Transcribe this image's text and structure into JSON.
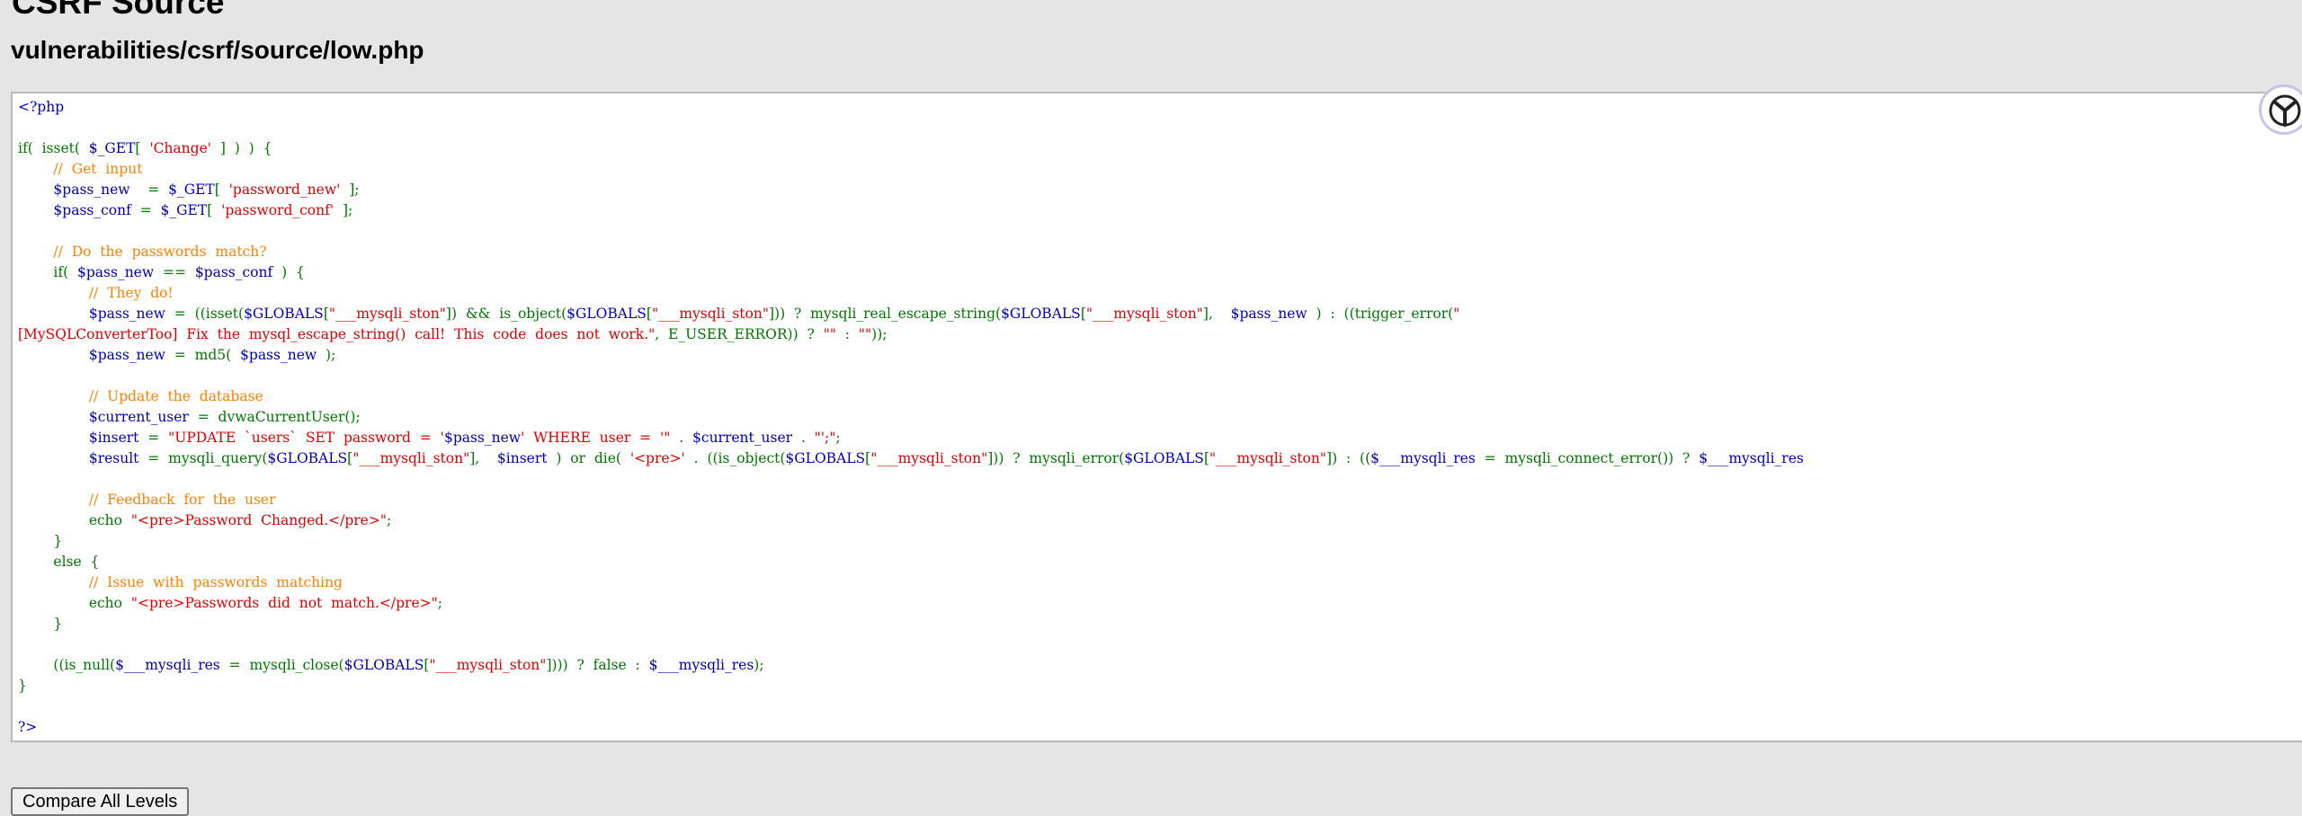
{
  "page": {
    "title": "CSRF Source",
    "file_path": "vulnerabilities/csrf/source/low.php"
  },
  "code_lines": [
    [
      [
        "html",
        "<?php"
      ]
    ],
    [],
    [
      [
        "d",
        "if(  isset(  "
      ],
      [
        "v",
        "$_GET"
      ],
      [
        "d",
        "[  "
      ],
      [
        "s",
        "'Change'"
      ],
      [
        "d",
        "  ]  )  )  {"
      ]
    ],
    [
      [
        "c",
        "        //  Get  input"
      ]
    ],
    [
      [
        "d",
        "        "
      ],
      [
        "v",
        "$pass_new"
      ],
      [
        "d",
        "    =  "
      ],
      [
        "v",
        "$_GET"
      ],
      [
        "d",
        "[  "
      ],
      [
        "s",
        "'password_new'"
      ],
      [
        "d",
        "  ];"
      ]
    ],
    [
      [
        "d",
        "        "
      ],
      [
        "v",
        "$pass_conf"
      ],
      [
        "d",
        "  =  "
      ],
      [
        "v",
        "$_GET"
      ],
      [
        "d",
        "[  "
      ],
      [
        "s",
        "'password_conf'"
      ],
      [
        "d",
        "  ];"
      ]
    ],
    [],
    [
      [
        "c",
        "        //  Do  the  passwords  match?"
      ]
    ],
    [
      [
        "d",
        "        if(  "
      ],
      [
        "v",
        "$pass_new"
      ],
      [
        "d",
        "  ==  "
      ],
      [
        "v",
        "$pass_conf"
      ],
      [
        "d",
        "  )  {"
      ]
    ],
    [
      [
        "c",
        "                //  They  do!"
      ]
    ],
    [
      [
        "d",
        "                "
      ],
      [
        "v",
        "$pass_new"
      ],
      [
        "d",
        "  =  ((isset("
      ],
      [
        "v",
        "$GLOBALS"
      ],
      [
        "d",
        "["
      ],
      [
        "s",
        "\"___mysqli_ston\""
      ],
      [
        "d",
        "])  &&  is_object("
      ],
      [
        "v",
        "$GLOBALS"
      ],
      [
        "d",
        "["
      ],
      [
        "s",
        "\"___mysqli_ston\""
      ],
      [
        "d",
        "]))  ?  mysqli_real_escape_string("
      ],
      [
        "v",
        "$GLOBALS"
      ],
      [
        "d",
        "["
      ],
      [
        "s",
        "\"___mysqli_ston\""
      ],
      [
        "d",
        "],    "
      ],
      [
        "v",
        "$pass_new"
      ],
      [
        "d",
        "  )  :  ((trigger_error("
      ],
      [
        "s",
        "\""
      ]
    ],
    [
      [
        "s",
        "[MySQLConverterToo]  Fix  the  mysql_escape_string()  call!  This  code  does  not  work.\""
      ],
      [
        "d",
        ",  E_USER_ERROR))  ?  "
      ],
      [
        "s",
        "\"\""
      ],
      [
        "d",
        "  :  "
      ],
      [
        "s",
        "\"\""
      ],
      [
        "d",
        "));"
      ]
    ],
    [
      [
        "d",
        "                "
      ],
      [
        "v",
        "$pass_new"
      ],
      [
        "d",
        "  =  md5(  "
      ],
      [
        "v",
        "$pass_new"
      ],
      [
        "d",
        "  );"
      ]
    ],
    [],
    [
      [
        "c",
        "                //  Update  the  database"
      ]
    ],
    [
      [
        "d",
        "                "
      ],
      [
        "v",
        "$current_user"
      ],
      [
        "d",
        "  =  dvwaCurrentUser();"
      ]
    ],
    [
      [
        "d",
        "                "
      ],
      [
        "v",
        "$insert"
      ],
      [
        "d",
        "  =  "
      ],
      [
        "s",
        "\"UPDATE  `users`  SET  password  =  '"
      ],
      [
        "v",
        "$pass_new"
      ],
      [
        "s",
        "'  WHERE  user  =  '\""
      ],
      [
        "d",
        "  .  "
      ],
      [
        "v",
        "$current_user"
      ],
      [
        "d",
        "  .  "
      ],
      [
        "s",
        "\"';\""
      ],
      [
        "d",
        ";"
      ]
    ],
    [
      [
        "d",
        "                "
      ],
      [
        "v",
        "$result"
      ],
      [
        "d",
        "  =  mysqli_query("
      ],
      [
        "v",
        "$GLOBALS"
      ],
      [
        "d",
        "["
      ],
      [
        "s",
        "\"___mysqli_ston\""
      ],
      [
        "d",
        "],    "
      ],
      [
        "v",
        "$insert"
      ],
      [
        "d",
        "  )  or  die(  "
      ],
      [
        "s",
        "'<pre>'"
      ],
      [
        "d",
        "  .  ((is_object("
      ],
      [
        "v",
        "$GLOBALS"
      ],
      [
        "d",
        "["
      ],
      [
        "s",
        "\"___mysqli_ston\""
      ],
      [
        "d",
        "]))  ?  mysqli_error("
      ],
      [
        "v",
        "$GLOBALS"
      ],
      [
        "d",
        "["
      ],
      [
        "s",
        "\"___mysqli_ston\""
      ],
      [
        "d",
        "])  :  (("
      ],
      [
        "v",
        "$___mysqli_res"
      ],
      [
        "d",
        "  =  mysqli_connect_error())  ?  "
      ],
      [
        "v",
        "$___mysqli_res"
      ]
    ],
    [],
    [
      [
        "c",
        "                //  Feedback  for  the  user"
      ]
    ],
    [
      [
        "d",
        "                echo  "
      ],
      [
        "s",
        "\"<pre>Password  Changed.</pre>\""
      ],
      [
        "d",
        ";"
      ]
    ],
    [
      [
        "d",
        "        }"
      ]
    ],
    [
      [
        "d",
        "        else  {"
      ]
    ],
    [
      [
        "c",
        "                //  Issue  with  passwords  matching"
      ]
    ],
    [
      [
        "d",
        "                echo  "
      ],
      [
        "s",
        "\"<pre>Passwords  did  not  match.</pre>\""
      ],
      [
        "d",
        ";"
      ]
    ],
    [
      [
        "d",
        "        }"
      ]
    ],
    [],
    [
      [
        "d",
        "        ((is_null("
      ],
      [
        "v",
        "$___mysqli_res"
      ],
      [
        "d",
        "  =  mysqli_close("
      ],
      [
        "v",
        "$GLOBALS"
      ],
      [
        "d",
        "["
      ],
      [
        "s",
        "\"___mysqli_ston\""
      ],
      [
        "d",
        "])))  ?  false  :  "
      ],
      [
        "v",
        "$___mysqli_res"
      ],
      [
        "d",
        ");"
      ]
    ],
    [
      [
        "d",
        "}"
      ]
    ],
    [],
    [
      [
        "html",
        "?>"
      ]
    ]
  ],
  "buttons": {
    "compare_label": "Compare All Levels"
  },
  "colors": {
    "default": "#007700",
    "html": "#0000bb",
    "variable": "#0000bb",
    "string": "#dd0000",
    "comment": "#ff8000"
  },
  "icons": {
    "corner_logo": "extension-logo-icon"
  }
}
